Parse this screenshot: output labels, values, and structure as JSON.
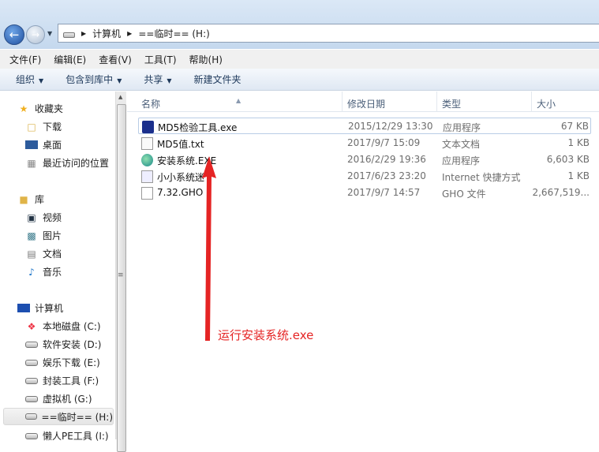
{
  "address": {
    "crumbs": [
      "计算机",
      "==临时== (H:)"
    ]
  },
  "menu": [
    "文件(F)",
    "编辑(E)",
    "查看(V)",
    "工具(T)",
    "帮助(H)"
  ],
  "toolbar": [
    "组织",
    "包含到库中",
    "共享",
    "新建文件夹"
  ],
  "sidebar": {
    "favorites": {
      "label": "收藏夹",
      "items": [
        "下载",
        "桌面",
        "最近访问的位置"
      ]
    },
    "libraries": {
      "label": "库",
      "items": [
        "视频",
        "图片",
        "文档",
        "音乐"
      ]
    },
    "computer": {
      "label": "计算机",
      "items": [
        "本地磁盘 (C:)",
        "软件安装 (D:)",
        "娱乐下载 (E:)",
        "封装工具 (F:)",
        "虚拟机 (G:)",
        "==临时== (H:)",
        "懒人PE工具 (I:)"
      ]
    }
  },
  "columns": [
    "名称",
    "修改日期",
    "类型",
    "大小"
  ],
  "files": [
    {
      "name": "MD5检验工具.exe",
      "date": "2015/12/29 13:30",
      "type": "应用程序",
      "size": "67 KB"
    },
    {
      "name": "MD5值.txt",
      "date": "2017/9/7 15:09",
      "type": "文本文档",
      "size": "1 KB"
    },
    {
      "name": "安装系统.EXE",
      "date": "2016/2/29 19:36",
      "type": "应用程序",
      "size": "6,603 KB"
    },
    {
      "name": "小小系统迷",
      "date": "2017/6/23 23:20",
      "type": "Internet 快捷方式",
      "size": "1 KB"
    },
    {
      "name": "7.32.GHO",
      "date": "2017/9/7 14:57",
      "type": "GHO 文件",
      "size": "2,667,519..."
    }
  ],
  "annotation": "运行安装系统.exe",
  "colors": {
    "annotation": "#e52424"
  }
}
